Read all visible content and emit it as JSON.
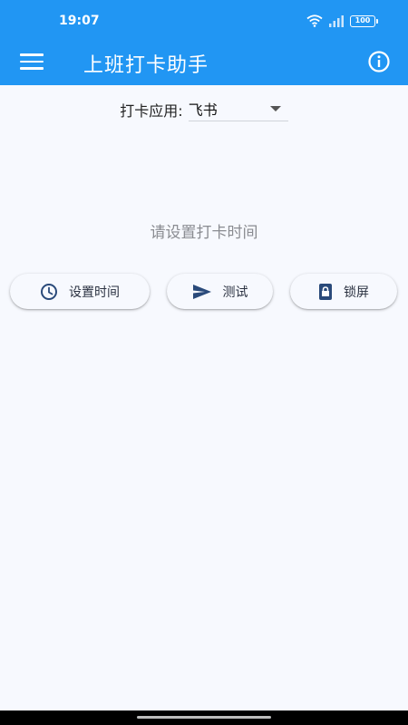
{
  "status_bar": {
    "time": "19:07",
    "battery": "100",
    "icons": [
      "wifi-icon",
      "signal-icon",
      "battery-icon"
    ]
  },
  "app_bar": {
    "title": "上班打卡助手",
    "menu_icon": "menu-icon",
    "info_icon": "info-icon",
    "color": "#2196f3"
  },
  "app_select": {
    "label": "打卡应用:",
    "value": "飞书"
  },
  "hint": "请设置打卡时间",
  "buttons": {
    "set_time": {
      "label": "设置时间",
      "icon": "clock-icon"
    },
    "test": {
      "label": "测试",
      "icon": "send-icon"
    },
    "lock": {
      "label": "锁屏",
      "icon": "lock-icon"
    }
  },
  "colors": {
    "primary": "#2196f3",
    "background": "#f7f9fe",
    "icon_dark": "#2a4a7a"
  }
}
